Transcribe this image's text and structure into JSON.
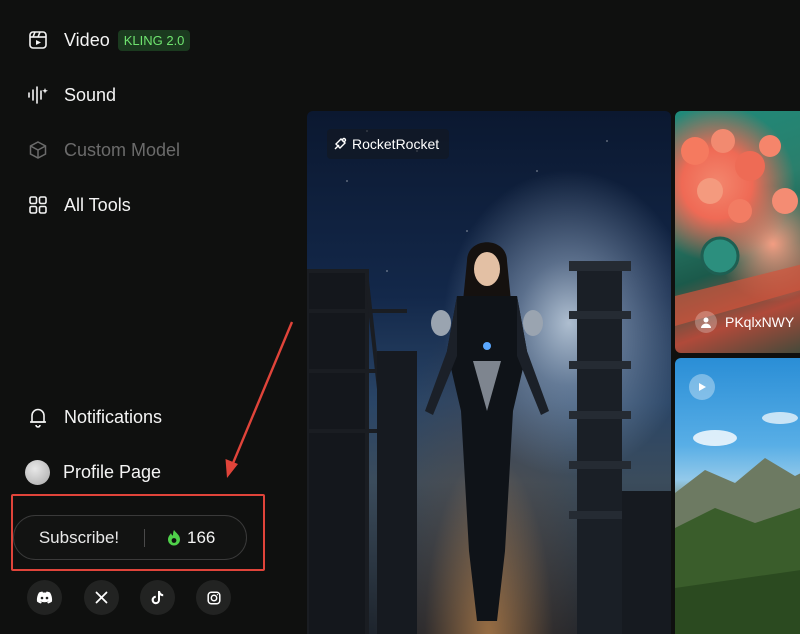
{
  "sidebar": {
    "items": [
      {
        "label": "Video",
        "badge": "KLING 2.0",
        "icon": "video-icon"
      },
      {
        "label": "Sound",
        "icon": "sound-wave-icon"
      },
      {
        "label": "Custom Model",
        "icon": "cube-icon"
      },
      {
        "label": "All Tools",
        "icon": "grid-icon"
      }
    ],
    "notifications": {
      "label": "Notifications",
      "icon": "bell-icon"
    },
    "profile": {
      "label": "Profile Page",
      "icon": "avatar"
    }
  },
  "subscribe": {
    "label": "Subscribe!",
    "credits": "166",
    "credits_icon": "flame-icon"
  },
  "social": [
    {
      "name": "discord-icon"
    },
    {
      "name": "x-icon"
    },
    {
      "name": "tiktok-icon"
    },
    {
      "name": "instagram-icon"
    }
  ],
  "gallery": {
    "main_tag": "RocketRocket",
    "top_right_author": "PKqlxNWY"
  },
  "colors": {
    "background": "#0f100f",
    "badge_text": "#6fe36f",
    "badge_bg": "#1b3a1f",
    "highlight": "#e0443a",
    "disabled_text": "#6b6b6b"
  }
}
